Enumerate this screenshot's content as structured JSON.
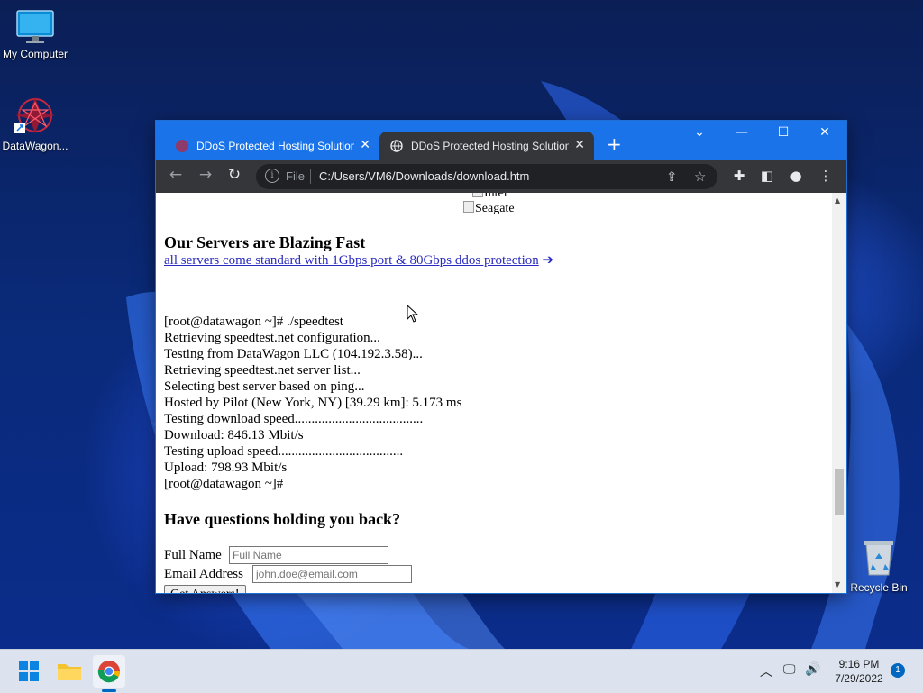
{
  "desktop": {
    "icons": [
      {
        "label": "My Computer"
      },
      {
        "label": "DataWagon..."
      },
      {
        "label": "Recycle Bin"
      }
    ]
  },
  "browser": {
    "tabs": [
      {
        "label": "DDoS Protected Hosting Solutions",
        "active": false
      },
      {
        "label": "DDoS Protected Hosting Solutions",
        "active": true
      }
    ],
    "new_tab": "+",
    "window_controls": {
      "dropdown": "⌄",
      "minimize": "—",
      "maximize": "☐",
      "close": "✕"
    },
    "address": {
      "scheme_label": "File",
      "url": "C:/Users/VM6/Downloads/download.htm"
    }
  },
  "page": {
    "img_alt_intel": "Intel",
    "img_alt_seagate": "Seagate",
    "servers_heading": "Our Servers are Blazing Fast",
    "servers_link": "all servers come standard with 1Gbps port & 80Gbps ddos protection",
    "speedtest_lines": [
      "[root@datawagon ~]# ./speedtest",
      "Retrieving speedtest.net configuration...",
      "Testing from DataWagon LLC (104.192.3.58)...",
      "Retrieving speedtest.net server list...",
      "Selecting best server based on ping...",
      "Hosted by Pilot (New York, NY) [39.29 km]: 5.173 ms",
      "Testing download speed......................................",
      "Download: 846.13 Mbit/s",
      "Testing upload speed.....................................",
      "Upload: 798.93 Mbit/s",
      "[root@datawagon ~]#"
    ],
    "questions_heading": "Have questions holding you back?",
    "form": {
      "full_name_label": "Full Name",
      "full_name_placeholder": "Full Name",
      "email_label": "Email Address",
      "email_placeholder": "john.doe@email.com",
      "submit_label": "Get Answers!"
    }
  },
  "taskbar": {
    "clock_time": "9:16 PM",
    "clock_date": "7/29/2022",
    "notification_count": "1"
  },
  "colors": {
    "tabbar": "#1a73e8",
    "toolbar": "#35363a",
    "link": "#2a2ac0",
    "taskbar": "#dce3ef"
  }
}
